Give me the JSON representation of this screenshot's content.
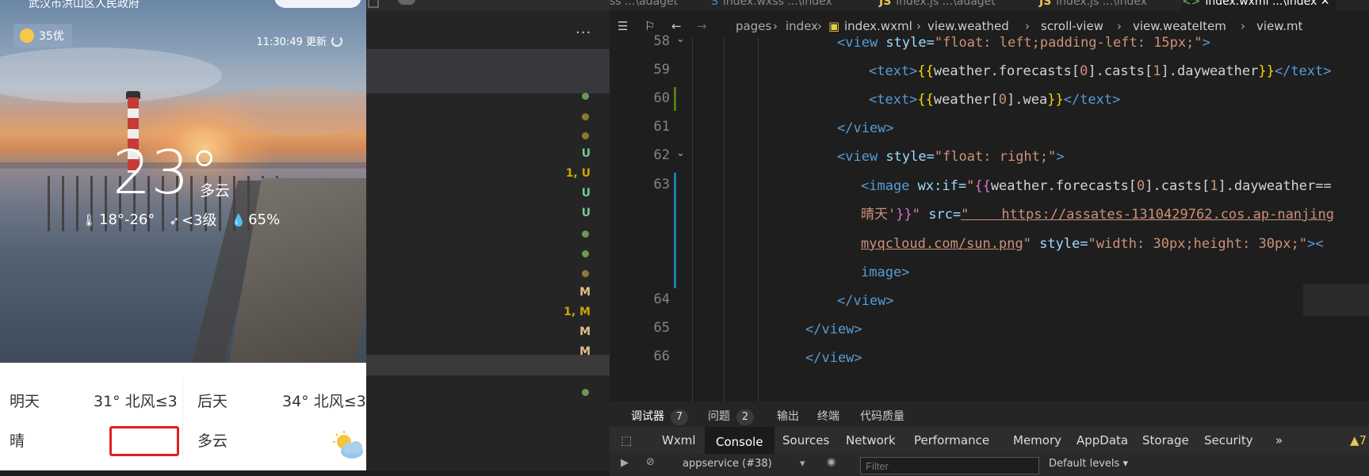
{
  "phone": {
    "location": "武汉市洪山区人民政府",
    "aqi": "35优",
    "update_time": "11:30:49 更新",
    "temperature": "23°",
    "condition": "多云",
    "temp_range": "18°-26°",
    "wind": "<3级",
    "humidity": "65%",
    "forecast": [
      {
        "day": "明天",
        "temp_wind": "31° 北风≤3",
        "weather": "晴"
      },
      {
        "day": "后天",
        "temp_wind": "34° 北风≤3",
        "weather": "多云"
      }
    ]
  },
  "middle_panel": {
    "more_label": "...",
    "git_status": [
      {
        "mark": "",
        "color": "#6a9955"
      },
      {
        "mark": "",
        "color": "#8a7a30"
      },
      {
        "mark": "",
        "color": "#8a7a30"
      },
      {
        "mark": "U",
        "color": "#73c991"
      },
      {
        "mark": "1, U",
        "color": "#cca700"
      },
      {
        "mark": "U",
        "color": "#73c991"
      },
      {
        "mark": "U",
        "color": "#73c991"
      },
      {
        "mark": "",
        "color": "#6a9955"
      },
      {
        "mark": "",
        "color": "#6a9955"
      },
      {
        "mark": "",
        "color": "#8a7a30"
      },
      {
        "mark": "M",
        "color": "#e2c08d"
      },
      {
        "mark": "1, M",
        "color": "#cca700"
      },
      {
        "mark": "M",
        "color": "#e2c08d"
      },
      {
        "mark": "M",
        "color": "#e2c08d"
      },
      {
        "mark": "",
        "color": "#6a9955"
      }
    ]
  },
  "editor": {
    "tabs": [
      {
        "name": "ss",
        "path": "...\\adaget"
      },
      {
        "name": "index.wxss",
        "path": "...\\index"
      },
      {
        "name": "index.js",
        "path": "...\\adaget"
      },
      {
        "name": "index.js",
        "path": "...\\index"
      },
      {
        "name": "index.wxml",
        "path": "...\\index"
      }
    ],
    "breadcrumb": [
      "pages",
      "index",
      "index.wxml",
      "view.weathed",
      "scroll-view",
      "view.weateItem",
      "view.mt"
    ],
    "line_numbers": [
      "58",
      "59",
      "60",
      "61",
      "62",
      "63",
      "",
      "",
      "",
      "64",
      "65",
      "66"
    ],
    "code": {
      "l58_a": "<view",
      "l58_b": " style=",
      "l58_c": "\"float: left;padding-left: 15px;\"",
      "l58_d": ">",
      "l59_a": "<text>",
      "l59_b": "{{",
      "l59_c": "weather.forecasts[",
      "l59_d": "0",
      "l59_e": "].casts[",
      "l59_f": "1",
      "l59_g": "].dayweather",
      "l59_h": "}}",
      "l59_i": "</text>",
      "l60_a": "<text>",
      "l60_b": "{{",
      "l60_c": "weather[",
      "l60_d": "0",
      "l60_e": "].wea",
      "l60_f": "}}",
      "l60_g": "</text>",
      "l61": "</view>",
      "l62_a": "<view",
      "l62_b": " style=",
      "l62_c": "\"float: right;\"",
      "l62_d": ">",
      "l63_a": "<image",
      "l63_b": " wx:if=",
      "l63_c": "\"",
      "l63_d": "{{",
      "l63_e": "weather.forecasts[",
      "l63_f": "0",
      "l63_g": "].casts[",
      "l63_h": "1",
      "l63_i": "].dayweather==",
      "l63b_a": "晴天",
      "l63b_b": "'",
      "l63b_c": "}}",
      "l63b_d": "\"",
      "l63b_e": " src=",
      "l63b_f": "\"    https://assates-1310429762.cos.ap-nanjing",
      "l63c_a": "myqcloud.com/sun.png",
      "l63c_b": "\"",
      "l63c_c": " style=",
      "l63c_d": "\"width: 30px;height: 30px;\"",
      "l63c_e": "><",
      "l63d_a": "image",
      "l63d_b": ">",
      "l64": "</view>",
      "l65": "</view>",
      "l66": "</view>"
    }
  },
  "devtools": {
    "top_tabs": [
      {
        "label": "调试器",
        "count": "7"
      },
      {
        "label": "问题",
        "count": "2"
      },
      {
        "label": "输出",
        "count": ""
      },
      {
        "label": "终端",
        "count": ""
      },
      {
        "label": "代码质量",
        "count": ""
      }
    ],
    "panel_tabs": [
      "Wxml",
      "Console",
      "Sources",
      "Network",
      "Performance",
      "Memory",
      "AppData",
      "Storage",
      "Security",
      "»"
    ],
    "warn_count": "7",
    "context": "appservice (#38)",
    "filter_placeholder": "Filter",
    "levels": "Default levels ▾"
  }
}
